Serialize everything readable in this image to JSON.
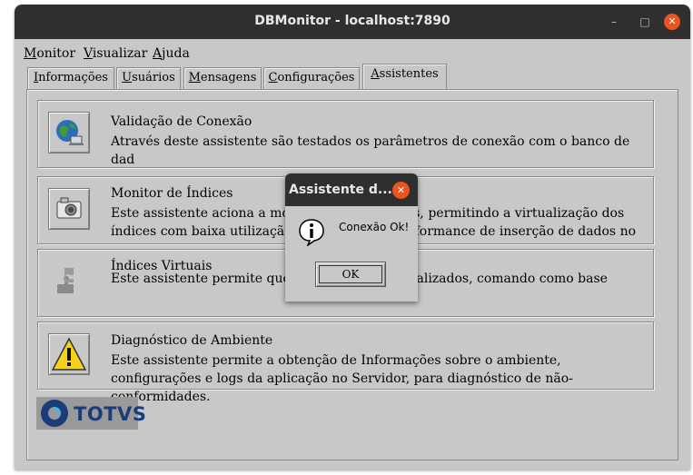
{
  "window": {
    "title": "DBMonitor - localhost:7890"
  },
  "menubar": {
    "items": [
      {
        "label": "Monitor",
        "accel": "M"
      },
      {
        "label": "Visualizar",
        "accel": "V"
      },
      {
        "label": "Ajuda",
        "accel": "A"
      }
    ]
  },
  "tabs": [
    {
      "label": "Informações",
      "active": false
    },
    {
      "label": "Usuários",
      "active": false
    },
    {
      "label": "Mensagens",
      "active": false
    },
    {
      "label": "Configurações",
      "active": false
    },
    {
      "label": "Assistentes",
      "active": true
    }
  ],
  "assistants": [
    {
      "icon": "globe-network-icon",
      "title": "Validação de Conexão",
      "desc": "Através deste assistente são testados os parâmetros de conexão com o banco de dad"
    },
    {
      "icon": "camera-icon",
      "title": "Monitor de Índices",
      "desc": "Este assistente aciona a monitoração de índices, permitindo a virtualização dos índices com baixa utilização, melhorando a performance de inserção de dados no sistema."
    },
    {
      "icon": "puzzle-icon",
      "title": "Índices Virtuais",
      "desc": "Este assistente permite que índices sejam virtualizados, comando como base"
    },
    {
      "icon": "warning-icon",
      "title": "Diagnóstico de Ambiente",
      "desc": "Este assistente permite a obtenção de Informações sobre o ambiente, configurações e logs da aplicação no Servidor, para diagnóstico de não-conformidades."
    }
  ],
  "dialog": {
    "title": "Assistente d...",
    "message": "Conexão Ok!",
    "ok_label": "OK"
  },
  "logo": {
    "text": "TOTVS"
  },
  "colors": {
    "accent_close": "#e95420",
    "titlebar": "#2f2f2f",
    "window_bg": "#c8c8c8",
    "logo_blue": "#1a3d7a"
  }
}
